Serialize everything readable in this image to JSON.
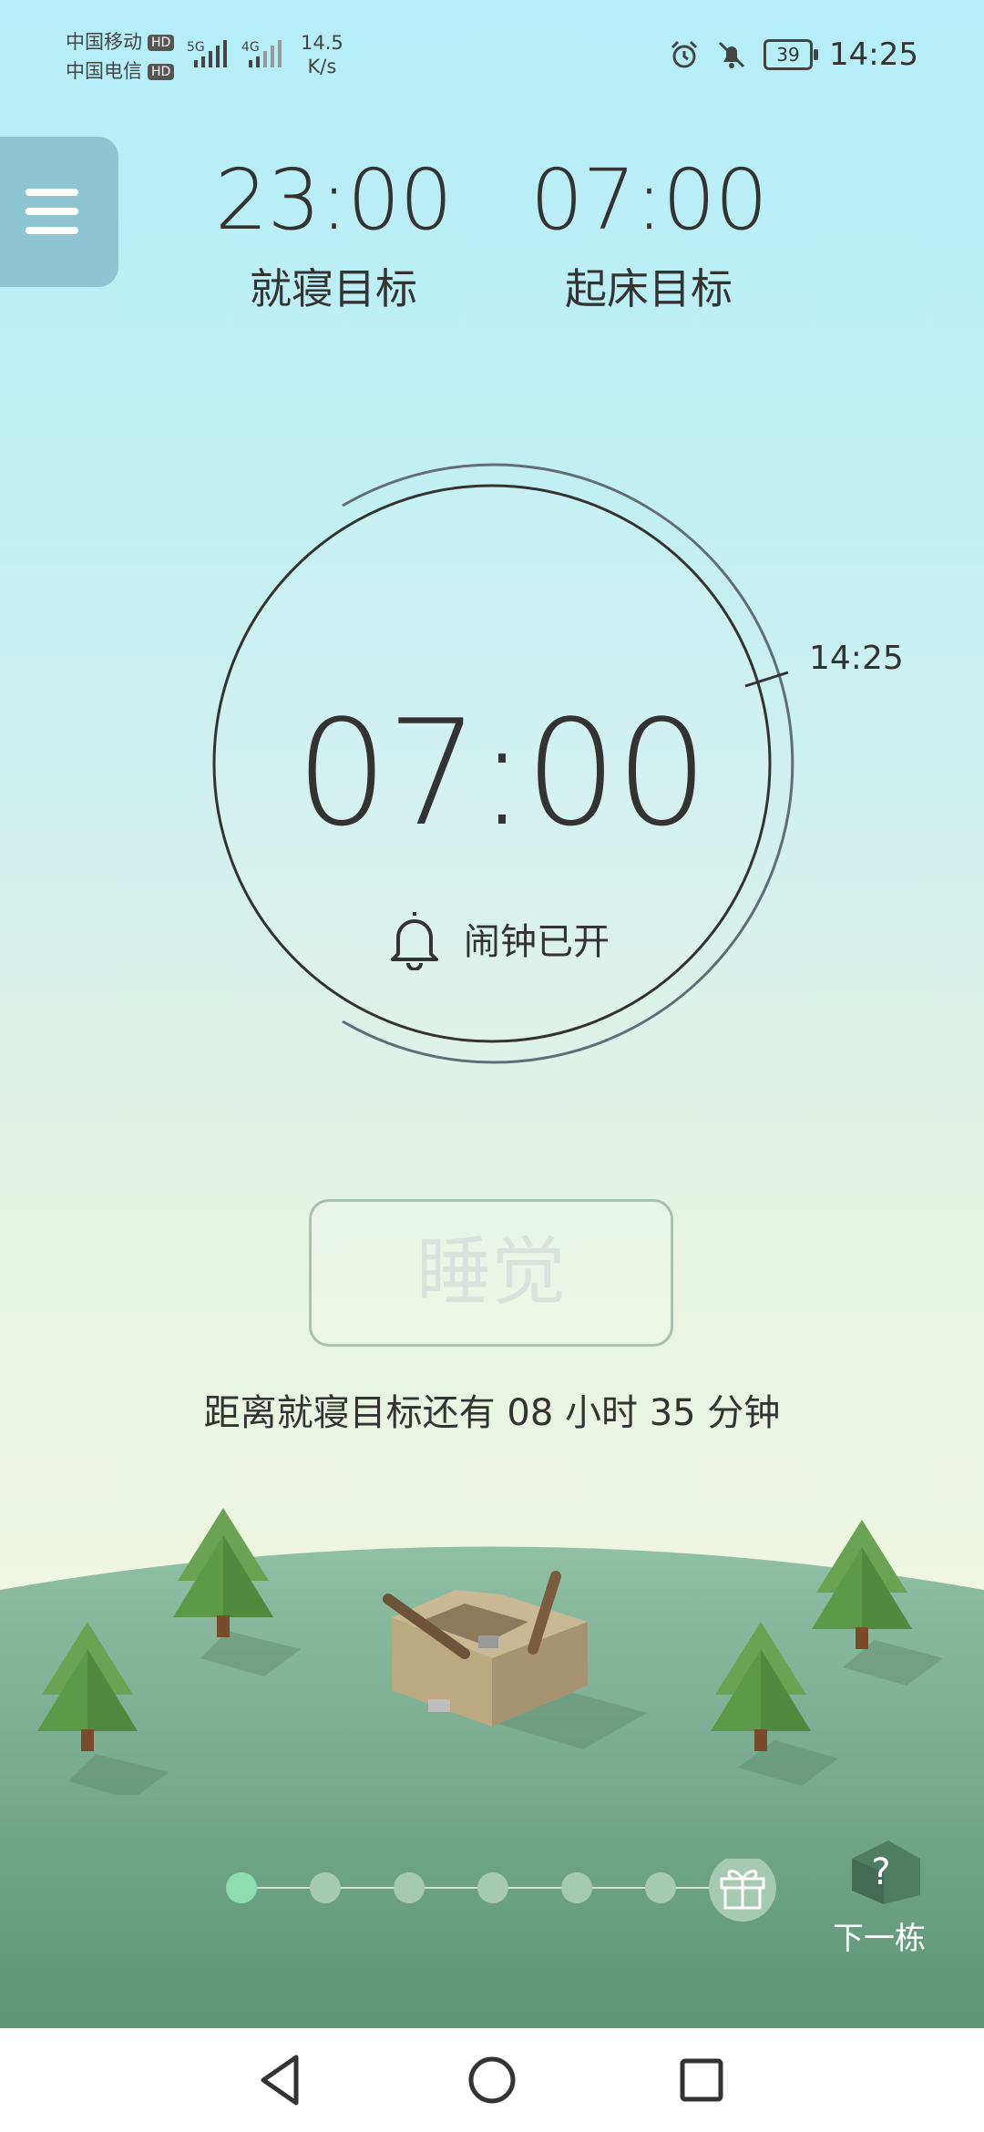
{
  "status_bar": {
    "carrier1": "中国移动",
    "carrier2": "中国电信",
    "hd": "HD",
    "sig1_label": "5G",
    "sig2_label": "4G",
    "net_speed_value": "14.5",
    "net_speed_unit": "K/s",
    "battery": "39",
    "time": "14:25"
  },
  "goals": {
    "bedtime": {
      "value": "23:00",
      "label": "就寝目标"
    },
    "wake": {
      "value": "07:00",
      "label": "起床目标"
    }
  },
  "clock": {
    "time": "07:00",
    "alarm_text": "闹钟已开",
    "current_time": "14:25"
  },
  "sleep_button": {
    "label": "睡觉"
  },
  "remaining_text": "距离就寝目标还有 08 小时 35 分钟",
  "next_building": {
    "icon_text": "?",
    "label": "下一栋"
  },
  "progress": {
    "total_dots": 6,
    "current_index": 0
  }
}
